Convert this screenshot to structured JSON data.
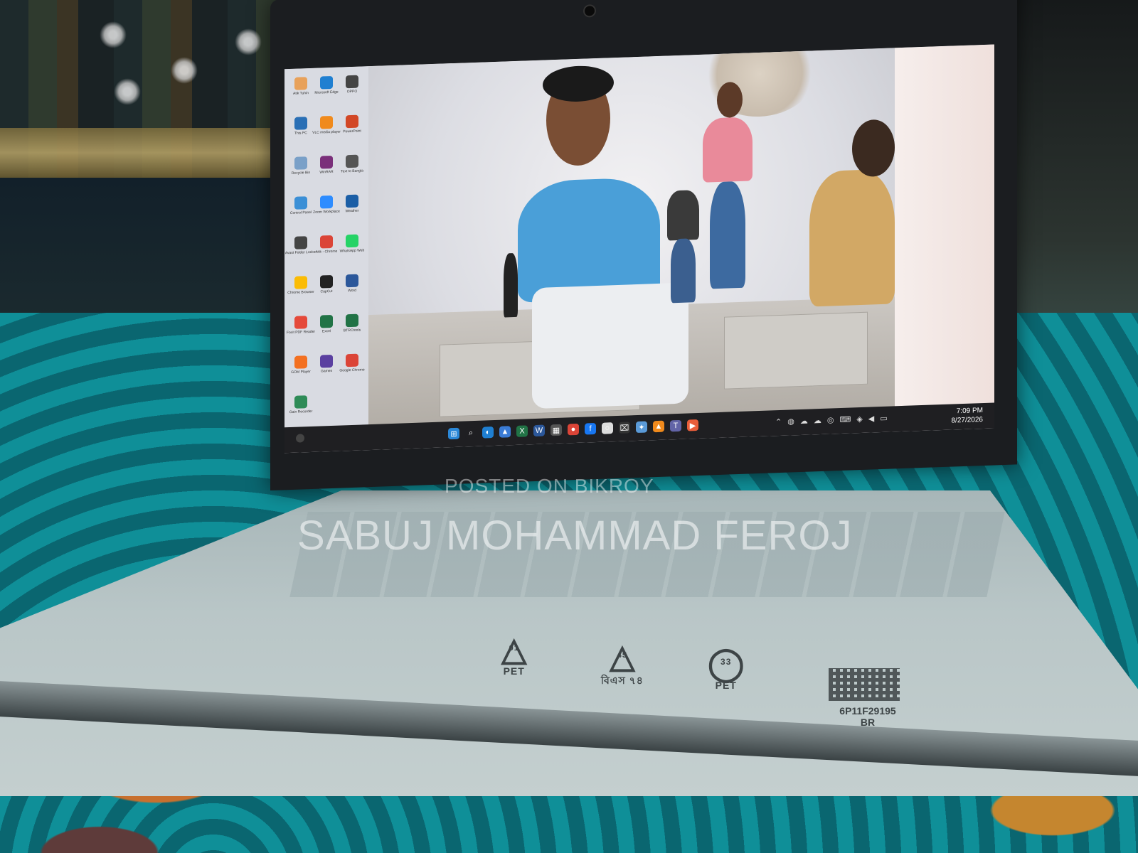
{
  "desktop_icons": [
    {
      "label": "Atik Tuhin",
      "color": "#e8a15a"
    },
    {
      "label": "Microsoft Edge",
      "color": "#1f7fd1"
    },
    {
      "label": "OPPO",
      "color": "#444"
    },
    {
      "label": "This PC",
      "color": "#2a6fb5"
    },
    {
      "label": "VLC media player",
      "color": "#f08a1c"
    },
    {
      "label": "PowerPoint",
      "color": "#d24726"
    },
    {
      "label": "Recycle Bin",
      "color": "#7aa0c8"
    },
    {
      "label": "WinRAR",
      "color": "#7a2f7a"
    },
    {
      "label": "Text to Bangla",
      "color": "#555"
    },
    {
      "label": "Control Panel",
      "color": "#3b8fd6"
    },
    {
      "label": "Zoom Workplace",
      "color": "#2d8cff"
    },
    {
      "label": "Weather",
      "color": "#1b5ea6"
    },
    {
      "label": "Avast Folder Locker",
      "color": "#444"
    },
    {
      "label": "Atik - Chrome",
      "color": "#db4437"
    },
    {
      "label": "WhatsApp Web",
      "color": "#25d366"
    },
    {
      "label": "Chrome Browser",
      "color": "#fbbc05"
    },
    {
      "label": "CapCut",
      "color": "#222"
    },
    {
      "label": "Word",
      "color": "#2b579a"
    },
    {
      "label": "Foxit PDF Reader",
      "color": "#e5493a"
    },
    {
      "label": "Excel",
      "color": "#217346"
    },
    {
      "label": "BTRCtools",
      "color": "#217346"
    },
    {
      "label": "GOM Player",
      "color": "#f37021"
    },
    {
      "label": "Games",
      "color": "#5a3fa0"
    },
    {
      "label": "Google Chrome",
      "color": "#db4437"
    },
    {
      "label": "Gain Recorder",
      "color": "#2e8b57"
    }
  ],
  "taskbar": {
    "icons": [
      {
        "name": "windows-start-icon",
        "glyph": "⊞",
        "color": "#2b88d8"
      },
      {
        "name": "search-icon",
        "glyph": "⌕",
        "color": "#1f1f22"
      },
      {
        "name": "edge-icon",
        "glyph": "◐",
        "color": "#1f7fd1"
      },
      {
        "name": "photos-icon",
        "glyph": "▲",
        "color": "#3a7bd5"
      },
      {
        "name": "excel-icon",
        "glyph": "X",
        "color": "#217346"
      },
      {
        "name": "word-icon",
        "glyph": "W",
        "color": "#2b579a"
      },
      {
        "name": "calendar-icon",
        "glyph": "▦",
        "color": "#555"
      },
      {
        "name": "chrome-icon",
        "glyph": "●",
        "color": "#db4437"
      },
      {
        "name": "facebook-icon",
        "glyph": "f",
        "color": "#1877f2"
      },
      {
        "name": "circle-app-icon",
        "glyph": "○",
        "color": "#ddd"
      },
      {
        "name": "capcut-icon",
        "glyph": "⌧",
        "color": "#333"
      },
      {
        "name": "copilot-icon",
        "glyph": "✦",
        "color": "#5a9ad8"
      },
      {
        "name": "vlc-icon",
        "glyph": "▲",
        "color": "#f08a1c"
      },
      {
        "name": "teams-icon",
        "glyph": "T",
        "color": "#6264a7"
      },
      {
        "name": "youtube-icon",
        "glyph": "▶",
        "color": "#e85d3a"
      }
    ],
    "clock_time": "7:09 PM",
    "clock_date": "8/27/2026"
  },
  "laptop_markings": {
    "pet_label": "PET",
    "pet_number": "01",
    "code_number": "45",
    "code_text": "বিএস ৭৪",
    "pet2_number": "33",
    "pet2_label": "PET",
    "qr_text": "6P11F29195\nBR"
  },
  "watermark": {
    "small": "POSTED ON BIKROY",
    "big": "SABUJ MOHAMMAD FEROJ"
  }
}
